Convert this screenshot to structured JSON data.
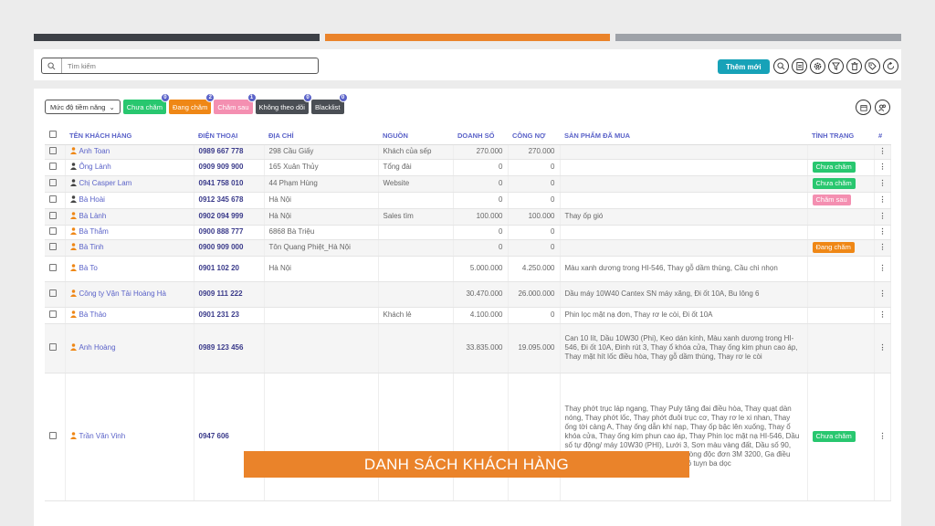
{
  "toolbar": {
    "search_placeholder": "Tìm kiếm",
    "add_label": "Thêm mới",
    "icons": [
      "search-icon",
      "document-icon",
      "settings-icon",
      "filter-icon",
      "trash-icon",
      "tag-icon",
      "refresh-icon"
    ]
  },
  "filters": {
    "select_label": "Mức độ tiềm năng",
    "chips": [
      {
        "label": "Chưa chăm",
        "count": "0",
        "color": "#28c76f"
      },
      {
        "label": "Đang chăm",
        "count": "2",
        "color": "#ef8716"
      },
      {
        "label": "Chăm sau",
        "count": "1",
        "color": "#f48fb1"
      },
      {
        "label": "Không theo dõi",
        "count": "0",
        "color": "#4a4e54"
      },
      {
        "label": "Blacklist",
        "count": "0",
        "color": "#4a4e54"
      }
    ]
  },
  "table": {
    "headers": [
      "TÊN KHÁCH HÀNG",
      "ĐIỆN THOẠI",
      "ĐỊA CHỈ",
      "NGUỒN",
      "DOANH SỐ",
      "CÔNG NỢ",
      "SẢN PHẨM ĐÃ MUA",
      "TÌNH TRẠNG",
      "#"
    ],
    "rows": [
      {
        "name": "Anh Toan",
        "phone": "0989 667 778",
        "address": "298 Cầu Giấy",
        "source": "Khách của sếp",
        "revenue": "270.000",
        "debt": "270.000",
        "products": "",
        "status": "",
        "icon_color": "#ef8716",
        "alt": true
      },
      {
        "name": "Ông Lành",
        "phone": "0909 909 900",
        "address": "165 Xuân Thủy",
        "source": "Tổng đài",
        "revenue": "0",
        "debt": "0",
        "products": "",
        "status": "Chưa chăm",
        "status_color": "#28c76f",
        "icon_color": "#444",
        "alt": false
      },
      {
        "name": "Chị Casper Lam",
        "phone": "0941 758 010",
        "address": "44 Phạm Hùng",
        "source": "Website",
        "revenue": "0",
        "debt": "0",
        "products": "",
        "status": "Chưa chăm",
        "status_color": "#28c76f",
        "icon_color": "#444",
        "alt": true
      },
      {
        "name": "Bà Hoài",
        "phone": "0912 345 678",
        "address": "Hà Nội",
        "source": "",
        "revenue": "0",
        "debt": "0",
        "products": "",
        "status": "Chăm sau",
        "status_color": "#f48fb1",
        "icon_color": "#444",
        "alt": false
      },
      {
        "name": "Bà Lành",
        "phone": "0902 094 999",
        "address": "Hà Nội",
        "source": "Sales tìm",
        "revenue": "100.000",
        "debt": "100.000",
        "products": "Thay ốp gió",
        "status": "",
        "icon_color": "#ef8716",
        "alt": true
      },
      {
        "name": "Bà Thắm",
        "phone": "0900 888 777",
        "address": "6868 Bà Triệu",
        "source": "",
        "revenue": "0",
        "debt": "0",
        "products": "",
        "status": "",
        "icon_color": "#ef8716",
        "alt": false
      },
      {
        "name": "Bà Tinh",
        "phone": "0900 909 000",
        "address": "Tôn Quang Phiệt_Hà Nội",
        "source": "",
        "revenue": "0",
        "debt": "0",
        "products": "",
        "status": "Đang chăm",
        "status_color": "#ef8716",
        "icon_color": "#ef8716",
        "alt": true
      },
      {
        "name": "Bà To",
        "phone": "0901 102 20",
        "address": "Hà Nội",
        "source": "",
        "revenue": "5.000.000",
        "debt": "4.250.000",
        "products": "Màu xanh dương trong HI-546, Thay gỗ dầm thùng, Cầu chì nhọn",
        "status": "",
        "icon_color": "#ef8716",
        "alt": false
      },
      {
        "name": "Công ty Vận Tải Hoàng Hà",
        "phone": "0909 111 222",
        "address": "",
        "source": "",
        "revenue": "30.470.000",
        "debt": "26.000.000",
        "products": "Dầu máy 10W40 Cantex SN máy xăng, Đi ốt 10A, Bu lông 6",
        "status": "",
        "icon_color": "#ef8716",
        "alt": true
      },
      {
        "name": "Bà Thảo",
        "phone": "0901 231 23",
        "address": "",
        "source": "Khách lẻ",
        "revenue": "4.100.000",
        "debt": "0",
        "products": "Phin lọc mặt nạ đơn, Thay rơ le còi, Đi ốt 10A",
        "status": "",
        "icon_color": "#ef8716",
        "alt": false
      },
      {
        "name": "Anh Hoàng",
        "phone": "0989 123 456",
        "address": "",
        "source": "",
        "revenue": "33.835.000",
        "debt": "19.095.000",
        "products": "Can 10 lít, Dầu 10W30 (Phi), Keo dán kính, Màu xanh dương trong HI-546, Đi ốt 10A, Đinh rút 3, Thay ổ khóa cửa, Thay ống kim phun cao áp, Thay mặt hít lốc điều hòa, Thay gỗ dầm thùng, Thay rơ le còi",
        "status": "",
        "icon_color": "#ef8716",
        "alt": true
      },
      {
        "name": "Trần Văn Vinh",
        "phone": "0947 606",
        "address": "",
        "source": "",
        "revenue": "",
        "debt": "",
        "products": "Thay phớt trục láp ngang, Thay Puly tăng đai điều hòa, Thay quạt dàn nóng, Thay phớt lốc, Thay phớt đuôi trục cơ, Thay rơ le xi nhan, Thay ống tời càng A, Thay ống dẫn khí nạp, Thay ốp bậc lên xuống, Thay ổ khóa cửa, Thay ống kim phun cao áp, Thay Phin lọc mặt nạ HI-546, Dầu số tự động/ máy 10W30 (PHI), Lưới 3, Sơn màu vàng đất, Dầu số 90, Sơn lót D162, Thép hộp 10, Mặt nạ phòng độc đơn 3M 3200, Ga điều hòa, Que hàn phi 3, Đinh rút 3, Thay rô tuyn ba dọc",
        "status": "Chưa chăm",
        "status_color": "#28c76f",
        "icon_color": "#ef8716",
        "alt": false
      }
    ]
  },
  "banner": {
    "title": "DANH SÁCH KHÁCH HÀNG"
  },
  "colors": {
    "accent": "#ea832a",
    "primary": "#5a62c8",
    "teal": "#17a2b8"
  }
}
